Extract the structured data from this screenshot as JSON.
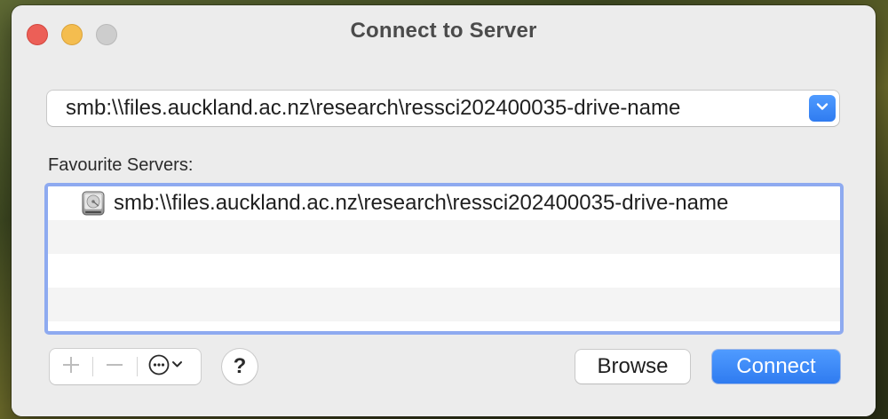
{
  "window": {
    "title": "Connect to Server"
  },
  "traffic_lights": {
    "close": "close",
    "minimize": "minimize",
    "zoom": "zoom"
  },
  "server_address": {
    "value": "smb:\\\\files.auckland.ac.nz\\research\\ressci202400035-drive-name",
    "dropdown_icon": "chevron-down-icon"
  },
  "favourites": {
    "label": "Favourite Servers:",
    "items": [
      {
        "icon": "network-drive-icon",
        "label": "smb:\\\\files.auckland.ac.nz\\research\\ressci202400035-drive-name"
      }
    ]
  },
  "toolbar": {
    "add_icon": "plus-icon",
    "remove_icon": "minus-icon",
    "more_icon": "ellipsis-circle-icon",
    "help_label": "?"
  },
  "buttons": {
    "browse_label": "Browse",
    "connect_label": "Connect"
  },
  "colors": {
    "accent": "#2f7bf0",
    "focus_ring": "#8eaaf0",
    "close": "#ec5f57",
    "minimize": "#f4bd4f",
    "zoom": "#cdcdcd"
  }
}
